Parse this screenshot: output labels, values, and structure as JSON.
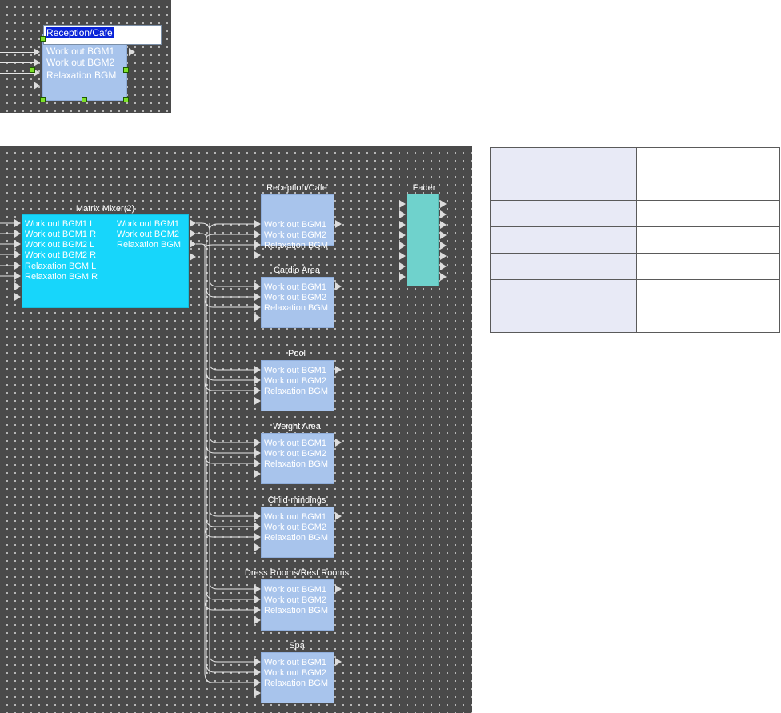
{
  "inset": {
    "edit_value": "Reception/Cafe",
    "ports": [
      "Work out BGM1",
      "Work out BGM2",
      "Relaxation BGM"
    ]
  },
  "matrix_mixer": {
    "title": "Matrix Mixer(2)",
    "inputs": [
      "Work out BGM1 L",
      "Work out BGM1 R",
      "Work out BGM2 L",
      "Work out BGM2 R",
      "Relaxation BGM L",
      "Relaxation BGM R"
    ],
    "outputs": [
      "Work out BGM1",
      "Work out BGM2",
      "Relaxation BGM"
    ]
  },
  "zones": [
    {
      "title": "Reception/Cafe",
      "ports": [
        "Work out BGM1",
        "Work out BGM2",
        "Relaxation BGM"
      ]
    },
    {
      "title": "Cardio Area",
      "ports": [
        "Work out BGM1",
        "Work out BGM2",
        "Relaxation BGM"
      ]
    },
    {
      "title": "Pool",
      "ports": [
        "Work out BGM1",
        "Work out BGM2",
        "Relaxation BGM"
      ]
    },
    {
      "title": "Weight Area",
      "ports": [
        "Work out BGM1",
        "Work out BGM2",
        "Relaxation BGM"
      ]
    },
    {
      "title": "Child-mindings",
      "ports": [
        "Work out BGM1",
        "Work out BGM2",
        "Relaxation BGM"
      ]
    },
    {
      "title": "Dress Rooms/Rest Rooms",
      "ports": [
        "Work out BGM1",
        "Work out BGM2",
        "Relaxation BGM"
      ]
    },
    {
      "title": "Spa",
      "ports": [
        "Work out BGM1",
        "Work out BGM2",
        "Relaxation BGM"
      ]
    }
  ],
  "fader": {
    "title": "Fader"
  },
  "colors": {
    "canvas": "#4a4a4a",
    "zone_block": "#a8c4ec",
    "matrix_block": "#17d6fb",
    "fader_block": "#6fd2cc",
    "selection_handle": "#7ee02a",
    "text_selection": "#0a24d8"
  }
}
